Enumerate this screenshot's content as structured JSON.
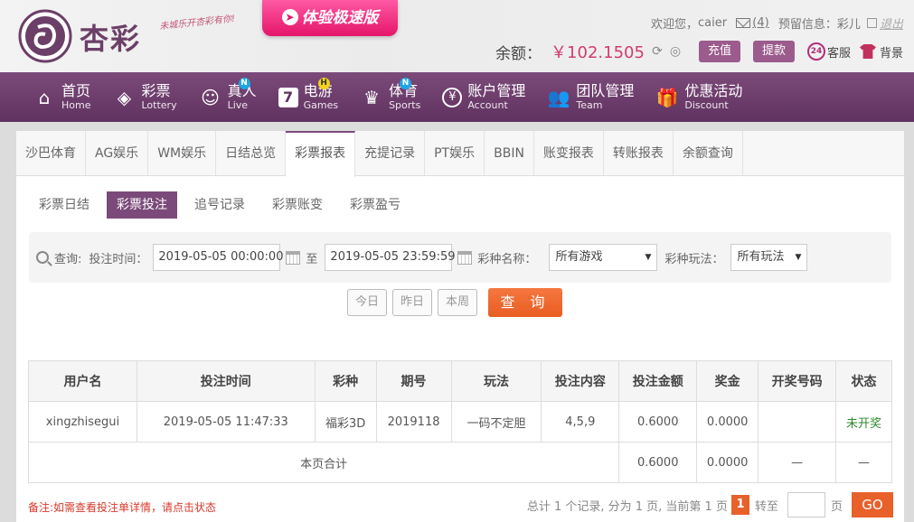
{
  "header": {
    "logo_text": "杏彩",
    "slogan": "未城乐开杏彩有你!",
    "promo_label": "体验极速版",
    "welcome_label": "欢迎您，",
    "username": "caier",
    "mail_count": "(4)",
    "reserve_label": "预留信息：",
    "reserve_value": "彩儿",
    "logout_label": "退出",
    "balance_label": "余额：",
    "balance_value": "￥102.1505",
    "recharge_label": "充值",
    "withdraw_label": "提款",
    "service_label": "客服",
    "background_label": "背景"
  },
  "nav": {
    "items": [
      {
        "cn": "首页",
        "en": "Home",
        "icon": "home-icon",
        "badge": ""
      },
      {
        "cn": "彩票",
        "en": "Lottery",
        "icon": "lottery-ticket-icon",
        "badge": ""
      },
      {
        "cn": "真人",
        "en": "Live",
        "icon": "live-dealer-icon",
        "badge": "N"
      },
      {
        "cn": "电游",
        "en": "Games",
        "icon": "slot-seven-icon",
        "badge": "H"
      },
      {
        "cn": "体育",
        "en": "Sports",
        "icon": "trophy-icon",
        "badge": "N"
      },
      {
        "cn": "账户管理",
        "en": "Account",
        "icon": "yen-coin-icon",
        "badge": ""
      },
      {
        "cn": "团队管理",
        "en": "Team",
        "icon": "team-icon",
        "badge": ""
      },
      {
        "cn": "优惠活动",
        "en": "Discount",
        "icon": "gift-icon",
        "badge": ""
      }
    ]
  },
  "tabs": [
    "沙巴体育",
    "AG娱乐",
    "WM娱乐",
    "日结总览",
    "彩票报表",
    "充提记录",
    "PT娱乐",
    "BBIN",
    "账变报表",
    "转账报表",
    "余额查询"
  ],
  "active_tab": 4,
  "subtabs": [
    "彩票日结",
    "彩票投注",
    "追号记录",
    "彩票账变",
    "彩票盈亏"
  ],
  "active_subtab": 1,
  "search": {
    "query_label": "查询:",
    "time_label": "投注时间：",
    "start_time": "2019-05-05 00:00:00",
    "to_label": "至",
    "end_time": "2019-05-05 23:59:59",
    "game_label": "彩种名称：",
    "game_value": "所有游戏",
    "play_label": "彩种玩法：",
    "play_value": "所有玩法"
  },
  "buttons": {
    "today": "今日",
    "yesterday": "昨日",
    "this_week": "本周",
    "query": "查 询"
  },
  "table": {
    "headers": [
      "用户名",
      "投注时间",
      "彩种",
      "期号",
      "玩法",
      "投注内容",
      "投注金额",
      "奖金",
      "开奖号码",
      "状态"
    ],
    "row": {
      "username": "xingzhisegui",
      "time": "2019-05-05 11:47:33",
      "lottery": "福彩3D",
      "issue": "2019118",
      "play": "一码不定胆",
      "content": "4,5,9",
      "amount": "0.6000",
      "prize": "0.0000",
      "draw": "",
      "status": "未开奖"
    },
    "total": {
      "label": "本页合计",
      "amount": "0.6000",
      "prize": "0.0000",
      "draw": "—",
      "status": "—"
    }
  },
  "note": "备注:如需查看投注单详情，请点击状态",
  "pager": {
    "summary": "总计 1 个记录, 分为 1 页, 当前第 1 页",
    "current": "1",
    "goto_label": "转至",
    "page_label": "页",
    "go_label": "GO"
  }
}
